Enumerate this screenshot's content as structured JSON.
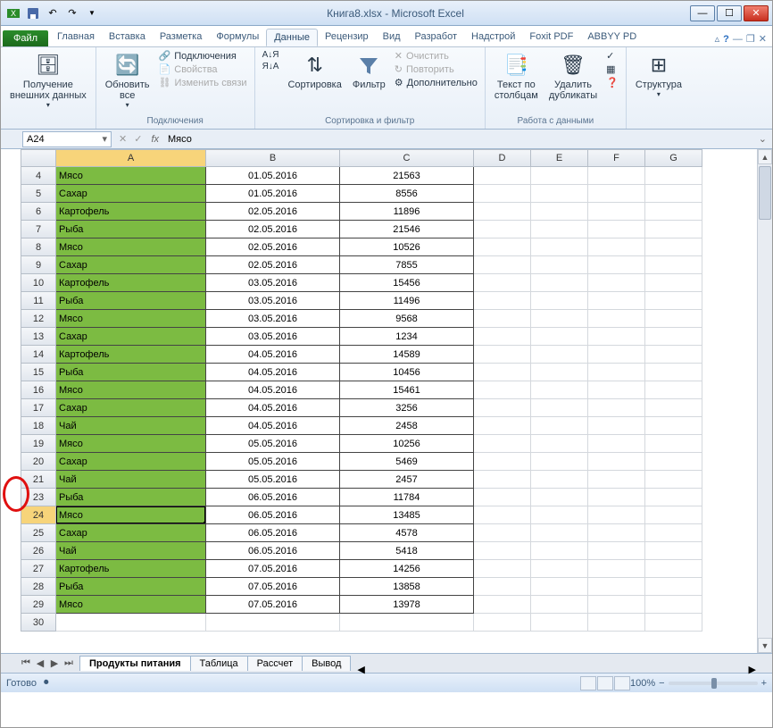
{
  "window": {
    "title": "Книга8.xlsx - Microsoft Excel"
  },
  "tabs": {
    "file": "Файл",
    "items": [
      "Главная",
      "Вставка",
      "Разметка",
      "Формулы",
      "Данные",
      "Рецензир",
      "Вид",
      "Разработ",
      "Надстрой",
      "Foxit PDF",
      "ABBYY PD"
    ],
    "active_index": 4
  },
  "ribbon": {
    "groups": {
      "external": {
        "label": "",
        "get_external": "Получение\nвнешних данных"
      },
      "connections": {
        "label": "Подключения",
        "refresh": "Обновить\nвсе",
        "conn": "Подключения",
        "props": "Свойства",
        "edit_links": "Изменить связи"
      },
      "sortfilter": {
        "label": "Сортировка и фильтр",
        "sort_az": "А↓Я",
        "sort_za": "Я↓А",
        "sort": "Сортировка",
        "filter": "Фильтр",
        "clear": "Очистить",
        "reapply": "Повторить",
        "advanced": "Дополнительно"
      },
      "datatools": {
        "label": "Работа с данными",
        "text_to_cols": "Текст по\nстолбцам",
        "remove_dupes": "Удалить\nдубликаты"
      },
      "outline": {
        "label": "",
        "structure": "Структура"
      }
    }
  },
  "namebox": {
    "ref": "A24",
    "fx": "fx",
    "formula": "Мясо"
  },
  "columns": [
    "A",
    "B",
    "C",
    "D",
    "E",
    "F",
    "G"
  ],
  "col_widths": {
    "A": 168,
    "B": 150,
    "C": 150,
    "D": 64,
    "E": 64,
    "F": 64,
    "G": 64
  },
  "selected": {
    "col": "A",
    "row": 24
  },
  "rows": [
    {
      "n": 4,
      "a": "Мясо",
      "b": "01.05.2016",
      "c": "21563"
    },
    {
      "n": 5,
      "a": "Сахар",
      "b": "01.05.2016",
      "c": "8556"
    },
    {
      "n": 6,
      "a": "Картофель",
      "b": "02.05.2016",
      "c": "11896"
    },
    {
      "n": 7,
      "a": "Рыба",
      "b": "02.05.2016",
      "c": "21546"
    },
    {
      "n": 8,
      "a": "Мясо",
      "b": "02.05.2016",
      "c": "10526"
    },
    {
      "n": 9,
      "a": "Сахар",
      "b": "02.05.2016",
      "c": "7855"
    },
    {
      "n": 10,
      "a": "Картофель",
      "b": "03.05.2016",
      "c": "15456"
    },
    {
      "n": 11,
      "a": "Рыба",
      "b": "03.05.2016",
      "c": "11496"
    },
    {
      "n": 12,
      "a": "Мясо",
      "b": "03.05.2016",
      "c": "9568"
    },
    {
      "n": 13,
      "a": "Сахар",
      "b": "03.05.2016",
      "c": "1234"
    },
    {
      "n": 14,
      "a": "Картофель",
      "b": "04.05.2016",
      "c": "14589"
    },
    {
      "n": 15,
      "a": "Рыба",
      "b": "04.05.2016",
      "c": "10456"
    },
    {
      "n": 16,
      "a": "Мясо",
      "b": "04.05.2016",
      "c": "15461"
    },
    {
      "n": 17,
      "a": "Сахар",
      "b": "04.05.2016",
      "c": "3256"
    },
    {
      "n": 18,
      "a": "Чай",
      "b": "04.05.2016",
      "c": "2458"
    },
    {
      "n": 19,
      "a": "Мясо",
      "b": "05.05.2016",
      "c": "10256"
    },
    {
      "n": 20,
      "a": "Сахар",
      "b": "05.05.2016",
      "c": "5469"
    },
    {
      "n": 21,
      "a": "Чай",
      "b": "05.05.2016",
      "c": "2457"
    },
    {
      "n": 23,
      "a": "Рыба",
      "b": "06.05.2016",
      "c": "11784"
    },
    {
      "n": 24,
      "a": "Мясо",
      "b": "06.05.2016",
      "c": "13485"
    },
    {
      "n": 25,
      "a": "Сахар",
      "b": "06.05.2016",
      "c": "4578"
    },
    {
      "n": 26,
      "a": "Чай",
      "b": "06.05.2016",
      "c": "5418"
    },
    {
      "n": 27,
      "a": "Картофель",
      "b": "07.05.2016",
      "c": "14256"
    },
    {
      "n": 28,
      "a": "Рыба",
      "b": "07.05.2016",
      "c": "13858"
    },
    {
      "n": 29,
      "a": "Мясо",
      "b": "07.05.2016",
      "c": "13978"
    }
  ],
  "blank_row": 30,
  "sheet_tabs": {
    "items": [
      "Продукты питания",
      "Таблица",
      "Рассчет",
      "Вывод"
    ],
    "active_index": 0
  },
  "status": {
    "ready": "Готово",
    "zoom": "100%"
  }
}
